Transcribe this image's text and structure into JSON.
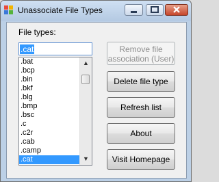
{
  "window": {
    "title": "Unassociate File Types"
  },
  "title_buttons": {
    "minimize": "minimize",
    "maximize": "maximize",
    "close": "close"
  },
  "main": {
    "file_types_label": "File types:",
    "file_type_input": ".cat",
    "file_types": [
      ".bat",
      ".bcp",
      ".bin",
      ".bkf",
      ".blg",
      ".bmp",
      ".bsc",
      ".c",
      ".c2r",
      ".cab",
      ".camp",
      ".cat"
    ],
    "selected_index": 11
  },
  "buttons": {
    "remove_line1": "Remove file",
    "remove_line2": "association (User)",
    "delete": "Delete file type",
    "refresh": "Refresh list",
    "about": "About",
    "homepage": "Visit Homepage"
  },
  "colors": {
    "selection": "#3399ff",
    "close_button": "#c6462b"
  }
}
